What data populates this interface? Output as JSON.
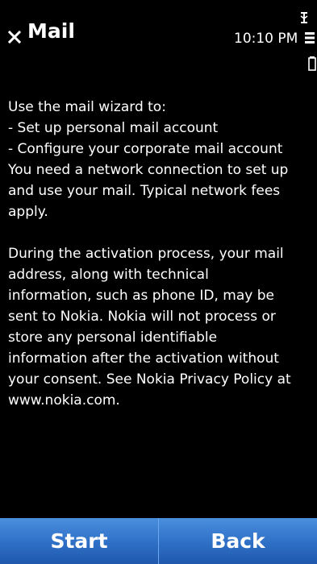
{
  "header": {
    "title": "Mail",
    "time": "10:10 PM"
  },
  "icons": {
    "close": "close-icon",
    "signal": "signal-icon",
    "menu": "menu-icon",
    "battery": "battery-icon"
  },
  "content": {
    "lines": [
      "Use the mail wizard to:",
      "- Set up personal mail account",
      "- Configure your corporate mail account",
      "You need a network connection to set up",
      "and use your mail. Typical network fees",
      "apply.",
      "",
      "During the activation process, your mail",
      "address, along with technical",
      "information, such as phone ID, may be",
      "sent to Nokia. Nokia will not process or",
      "store any personal identifiable",
      "information after the activation without",
      "your consent. See Nokia Privacy Policy at",
      "www.nokia.com."
    ]
  },
  "softkeys": {
    "start_label": "Start",
    "back_label": "Back"
  },
  "colors": {
    "background": "#000000",
    "text": "#ffffff",
    "softkey_top": "#4a8fde",
    "softkey_bottom": "#1f58ad"
  }
}
